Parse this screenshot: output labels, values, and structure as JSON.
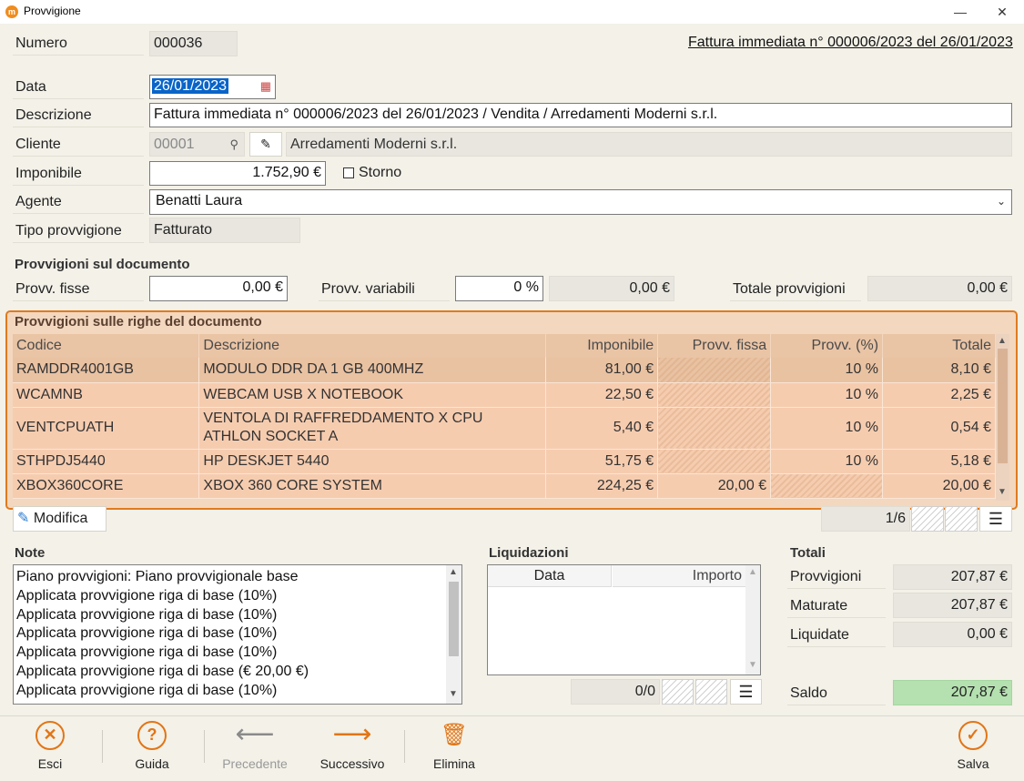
{
  "window": {
    "title": "Provvigione",
    "minimize": "—",
    "maximize": "☐",
    "close": "✕"
  },
  "header": {
    "numero_label": "Numero",
    "numero_value": "000036",
    "doc_link": "Fattura immediata n° 000006/2023 del 26/01/2023"
  },
  "form": {
    "data_label": "Data",
    "data_value": "26/01/2023",
    "descrizione_label": "Descrizione",
    "descrizione_value": "Fattura immediata n° 000006/2023 del 26/01/2023 / Vendita / Arredamenti Moderni s.r.l.",
    "cliente_label": "Cliente",
    "cliente_code": "00001",
    "cliente_name": "Arredamenti Moderni s.r.l.",
    "imponibile_label": "Imponibile",
    "imponibile_value": "1.752,90 €",
    "storno_label": "Storno",
    "agente_label": "Agente",
    "agente_value": "Benatti Laura",
    "tipo_label": "Tipo provvigione",
    "tipo_value": "Fatturato"
  },
  "doc_commissions": {
    "title": "Provvigioni sul documento",
    "fisse_label": "Provv. fisse",
    "fisse_value": "0,00 €",
    "variabili_label": "Provv. variabili",
    "variabili_pct": "0 %",
    "variabili_value": "0,00 €",
    "totale_label": "Totale provvigioni",
    "totale_value": "0,00 €"
  },
  "rows_grid": {
    "title": "Provvigioni sulle righe del documento",
    "columns": [
      "Codice",
      "Descrizione",
      "Imponibile",
      "Provv. fissa",
      "Provv. (%)",
      "Totale"
    ],
    "rows": [
      {
        "codice": "RAMDDR4001GB",
        "descrizione": "MODULO DDR DA 1 GB 400MHZ",
        "imponibile": "81,00 €",
        "fissa": "",
        "pct": "10 %",
        "totale": "8,10 €"
      },
      {
        "codice": "WCAMNB",
        "descrizione": "WEBCAM USB X NOTEBOOK",
        "imponibile": "22,50 €",
        "fissa": "",
        "pct": "10 %",
        "totale": "2,25 €"
      },
      {
        "codice": "VENTCPUATH",
        "descrizione": "VENTOLA DI RAFFREDDAMENTO X CPU",
        "descrizione2": "ATHLON SOCKET A",
        "imponibile": "5,40 €",
        "fissa": "",
        "pct": "10 %",
        "totale": "0,54 €"
      },
      {
        "codice": "STHPDJ5440",
        "descrizione": "HP DESKJET 5440",
        "imponibile": "51,75 €",
        "fissa": "",
        "pct": "10 %",
        "totale": "5,18 €"
      },
      {
        "codice": "XBOX360CORE",
        "descrizione": "XBOX 360 CORE SYSTEM",
        "imponibile": "224,25 €",
        "fissa": "20,00 €",
        "pct": "",
        "totale": "20,00 €"
      }
    ],
    "modifica_label": "Modifica",
    "pager": "1/6"
  },
  "notes": {
    "title": "Note",
    "lines": [
      "Piano provvigioni: Piano provvigionale base",
      "Applicata provvigione riga di base (10%)",
      "Applicata provvigione riga di base (10%)",
      "Applicata provvigione riga di base (10%)",
      "Applicata provvigione riga di base (10%)",
      "Applicata provvigione riga di base (€ 20,00 €)",
      "Applicata provvigione riga di base (10%)"
    ]
  },
  "liquidazioni": {
    "title": "Liquidazioni",
    "col_data": "Data",
    "col_importo": "Importo",
    "pager": "0/0"
  },
  "totali": {
    "title": "Totali",
    "provvigioni_label": "Provvigioni",
    "provvigioni_value": "207,87 €",
    "maturate_label": "Maturate",
    "maturate_value": "207,87 €",
    "liquidate_label": "Liquidate",
    "liquidate_value": "0,00 €",
    "saldo_label": "Saldo",
    "saldo_value": "207,87 €",
    "saldo_color": "#b5e0b0"
  },
  "toolbar": {
    "esci": "Esci",
    "guida": "Guida",
    "precedente": "Precedente",
    "successivo": "Successivo",
    "elimina": "Elimina",
    "salva": "Salva",
    "accent": "#e27516"
  },
  "icons": [
    "app-icon",
    "calendar-icon",
    "search-icon",
    "edit-icon",
    "chevron-down-icon",
    "close-circle-icon",
    "help-circle-icon",
    "arrow-left-icon",
    "arrow-right-icon",
    "trash-icon",
    "check-circle-icon",
    "menu-icon"
  ]
}
